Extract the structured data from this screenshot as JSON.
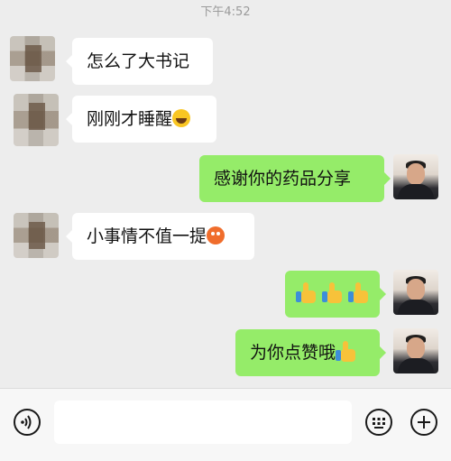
{
  "chat": {
    "timestamp": "下午4:52",
    "messages": [
      {
        "side": "in",
        "text": "怎么了大书记",
        "emoji": ""
      },
      {
        "side": "in",
        "text": "刚刚才睡醒",
        "emoji": "laughing-tears-emoji"
      },
      {
        "side": "out",
        "text": "感谢你的药品分享",
        "emoji": ""
      },
      {
        "side": "in",
        "text": "小事情不值一提",
        "emoji": "blushing-face-emoji"
      },
      {
        "side": "out",
        "text": "",
        "emoji": "thumbs-up-emoji x3"
      },
      {
        "side": "out",
        "text": "为你点赞哦",
        "emoji": "thumbs-up-emoji"
      }
    ]
  },
  "input_bar": {
    "voice_icon": "voice-icon",
    "input_value": "",
    "input_placeholder": "",
    "emoji_keyboard_icon": "keyboard-icon",
    "more_icon": "plus-icon"
  },
  "colors": {
    "background": "#ededed",
    "bubble_in": "#ffffff",
    "bubble_out": "#95ec69",
    "bottom_bar": "#f7f7f7"
  }
}
